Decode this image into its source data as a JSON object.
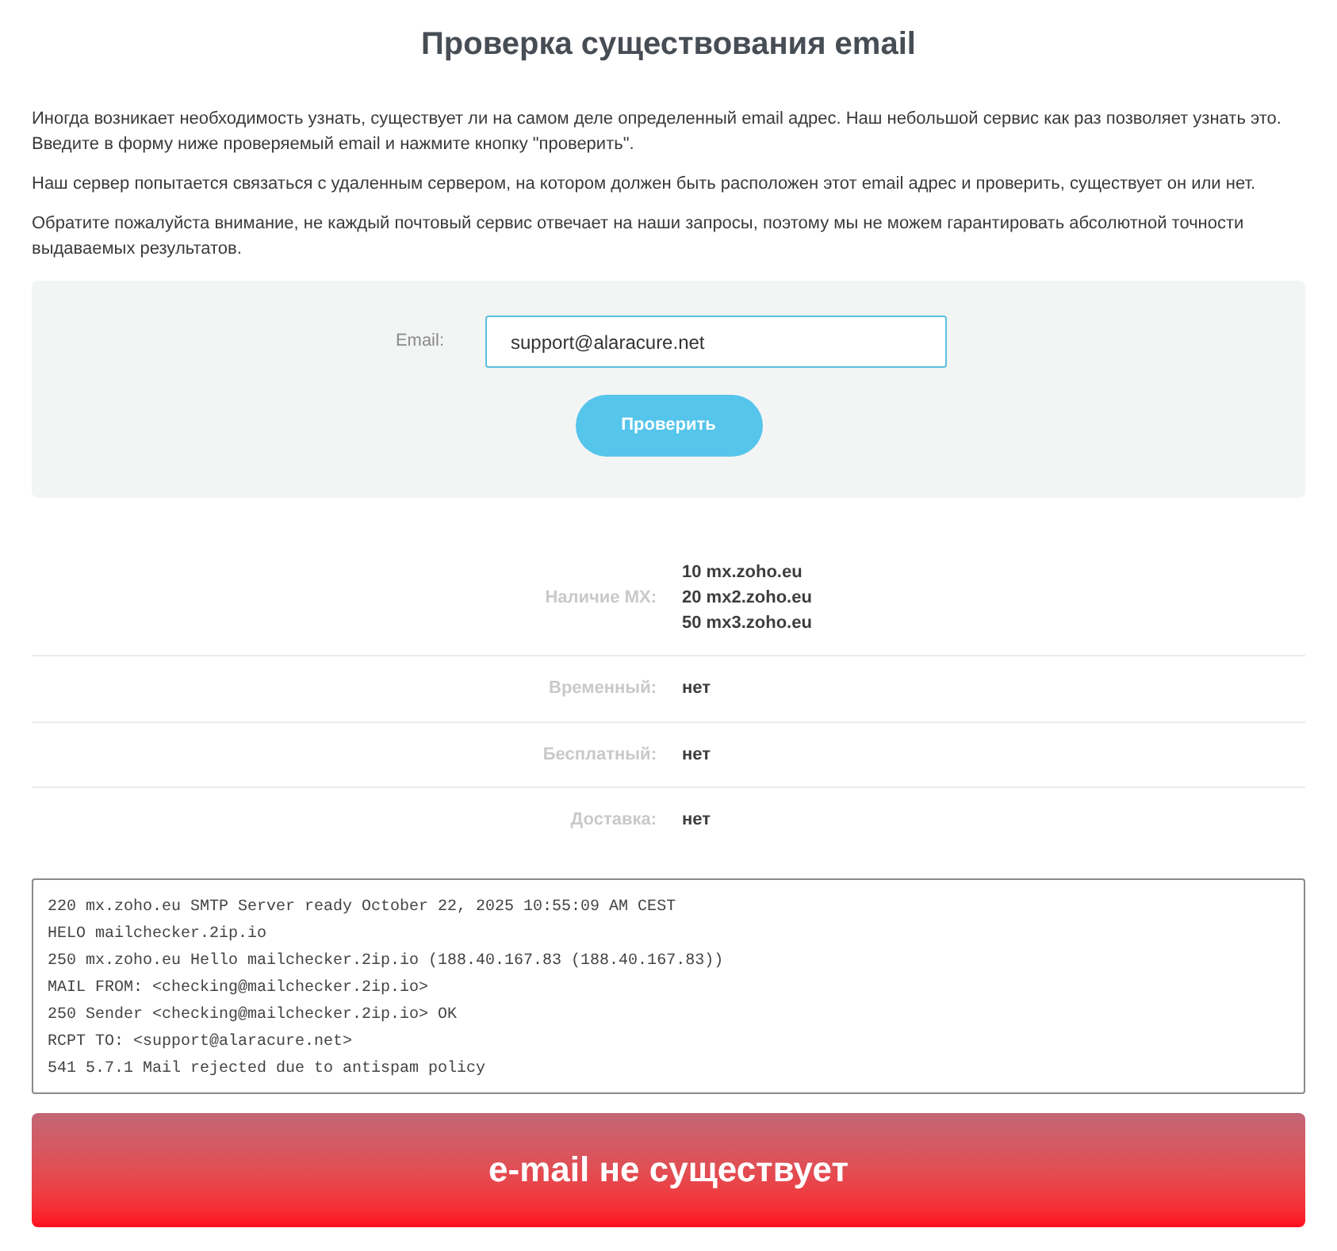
{
  "title": "Проверка существования email",
  "intro": [
    "Иногда возникает необходимость узнать, существует ли на самом деле определенный email адрес. Наш небольшой сервис как раз позволяет узнать это. Введите в форму ниже проверяемый email и нажмите кнопку \"проверить\".",
    "Наш сервер попытается связаться с удаленным сервером, на котором должен быть расположен этот email адрес и проверить, существует он или нет.",
    "Обратите пожалуйста внимание, не каждый почтовый сервис отвечает на наши запросы, поэтому мы не можем гарантировать абсолютной точности выдаваемых результатов."
  ],
  "form": {
    "label": "Email:",
    "value": "support@alaracure.net",
    "button": "Проверить"
  },
  "results": [
    {
      "label": "Наличие MX:",
      "values": [
        "**10** mx.zoho.eu",
        "**20** mx2.zoho.eu",
        "**50** mx3.zoho.eu"
      ]
    },
    {
      "label": "Временный:",
      "values": [
        "нет"
      ]
    },
    {
      "label": "Бесплатный:",
      "values": [
        "нет"
      ]
    },
    {
      "label": "Доставка:",
      "values": [
        "нет"
      ]
    }
  ],
  "log": [
    "220 mx.zoho.eu SMTP Server ready October 22, 2025 10:55:09 AM CEST",
    "HELO mailchecker.2ip.io",
    "250 mx.zoho.eu Hello mailchecker.2ip.io (188.40.167.83 (188.40.167.83))",
    "MAIL FROM: <checking@mailchecker.2ip.io>",
    "250 Sender <checking@mailchecker.2ip.io> OK",
    "RCPT TO: <support@alaracure.net>",
    "541 5.7.1 Mail rejected due to antispam policy"
  ],
  "verdict": {
    "kind": "error",
    "text": "e-mail не существует"
  }
}
